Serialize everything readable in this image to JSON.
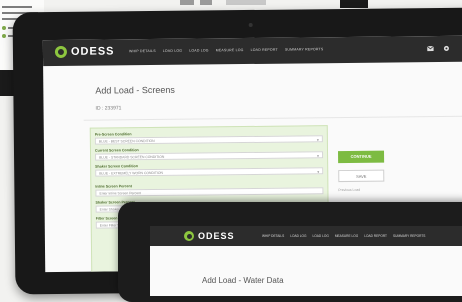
{
  "app": {
    "brand": "ODESS"
  },
  "nav": [
    "WHIP DETAILS",
    "LOAD LOG",
    "LOAD LOG",
    "MEASURE LOG",
    "LOAD REPORT",
    "SUMMARY REPORTS"
  ],
  "page": {
    "title": "Add Load - Screens",
    "id": "ID : 233971"
  },
  "form": {
    "fields": [
      {
        "label": "Pre-Screen Condition",
        "value": "BLUE - BEST SCREEN CONDITION",
        "type": "select"
      },
      {
        "label": "Current Screen Condition",
        "value": "BLUE - STANDARD SCREEN CONDITION",
        "type": "select"
      },
      {
        "label": "Shaker Screen Condition",
        "value": "BLUE - EXTREMELY WORN CONDITION",
        "type": "select"
      },
      {
        "label": "Inline Screen Percent",
        "value": "Enter Inline Screen Percent",
        "type": "input"
      },
      {
        "label": "Shaker Screen Percent",
        "value": "Enter Shaker Screen Percent",
        "type": "input"
      },
      {
        "label": "Filter Screen Percent",
        "value": "Enter Filter Screen Percent",
        "type": "input"
      }
    ]
  },
  "actions": {
    "continue": "CONTINUE",
    "save": "SAVE",
    "side_text_1": "Previous Load",
    "side_text_2": "Add Load Notes",
    "side_text_3": "Current Screen Condition"
  },
  "second_screen": {
    "brand": "ODESS",
    "nav": [
      "WHIP DETAILS",
      "LOAD LOG",
      "LOAD LOG",
      "MEASURE LOG",
      "LOAD REPORT",
      "SUMMARY REPORTS"
    ],
    "title": "Add Load - Water Data"
  },
  "colors": {
    "accent": "#7dbb42",
    "navbar": "#2c2c2c",
    "form_bg": "#e9f4de"
  },
  "icons": {
    "mail": "mail-icon",
    "gear": "gear-icon"
  }
}
